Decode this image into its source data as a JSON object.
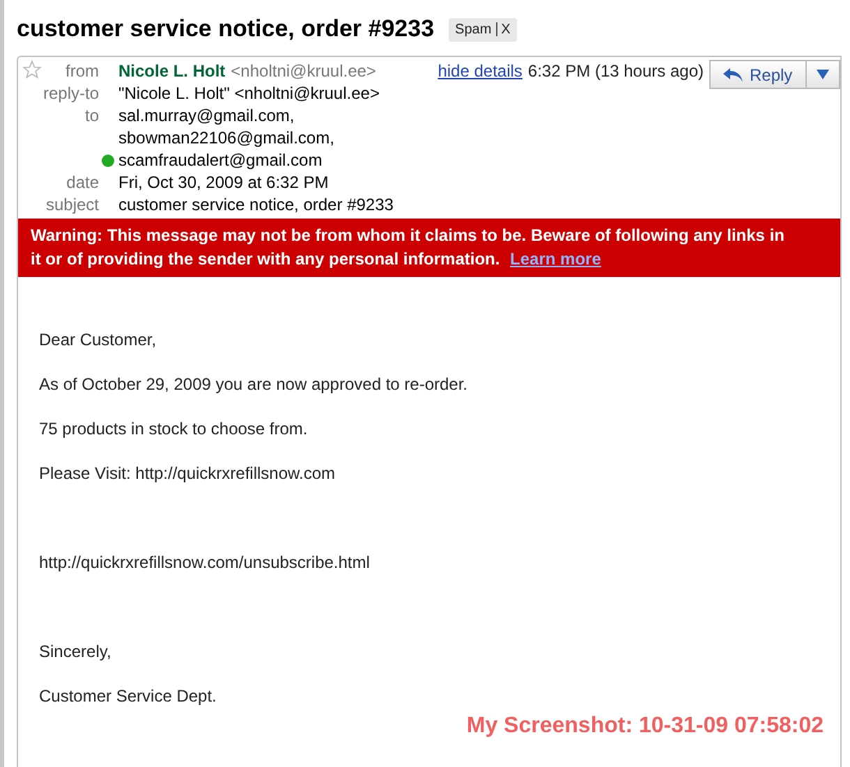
{
  "subject": "customer service notice, order #9233",
  "label": {
    "text": "Spam",
    "remove": "X"
  },
  "header": {
    "starred": false,
    "from": {
      "label": "from",
      "name": "Nicole L. Holt",
      "email": "<nholtni@kruul.ee>"
    },
    "hide_details": "hide details",
    "time": "6:32 PM (13 hours ago)",
    "reply": "Reply",
    "reply_to": {
      "label": "reply-to",
      "value": "\"Nicole L. Holt\" <nholtni@kruul.ee>"
    },
    "to": {
      "label": "to",
      "recipients": [
        {
          "address": "sal.murray@gmail.com,",
          "online": false
        },
        {
          "address": "sbowman22106@gmail.com,",
          "online": false
        },
        {
          "address": "scamfraudalert@gmail.com",
          "online": true
        }
      ]
    },
    "date": {
      "label": "date",
      "value": "Fri, Oct 30, 2009 at 6:32 PM"
    },
    "subject": {
      "label": "subject",
      "value": "customer service notice, order #9233"
    }
  },
  "warning": {
    "text": "Warning: This message may not be from whom it claims to be. Beware of following any links in it or of providing the sender with any personal information.",
    "link": "Learn more"
  },
  "body": [
    {
      "text": "Dear Customer,",
      "gap_after": false
    },
    {
      "text": "As of October 29, 2009 you are now approved to re-order.",
      "gap_after": false
    },
    {
      "text": "75 products in stock to choose from.",
      "gap_after": false
    },
    {
      "text": "Please Visit: http://quickrxrefillsnow.com",
      "gap_after": true
    },
    {
      "text": "http://quickrxrefillsnow.com/unsubscribe.html",
      "gap_after": true
    },
    {
      "text": "Sincerely,",
      "gap_after": false
    },
    {
      "text": "Customer Service Dept.",
      "gap_after": false
    }
  ],
  "screenshot_stamp": "My Screenshot: 10-31-09 07:58:02"
}
